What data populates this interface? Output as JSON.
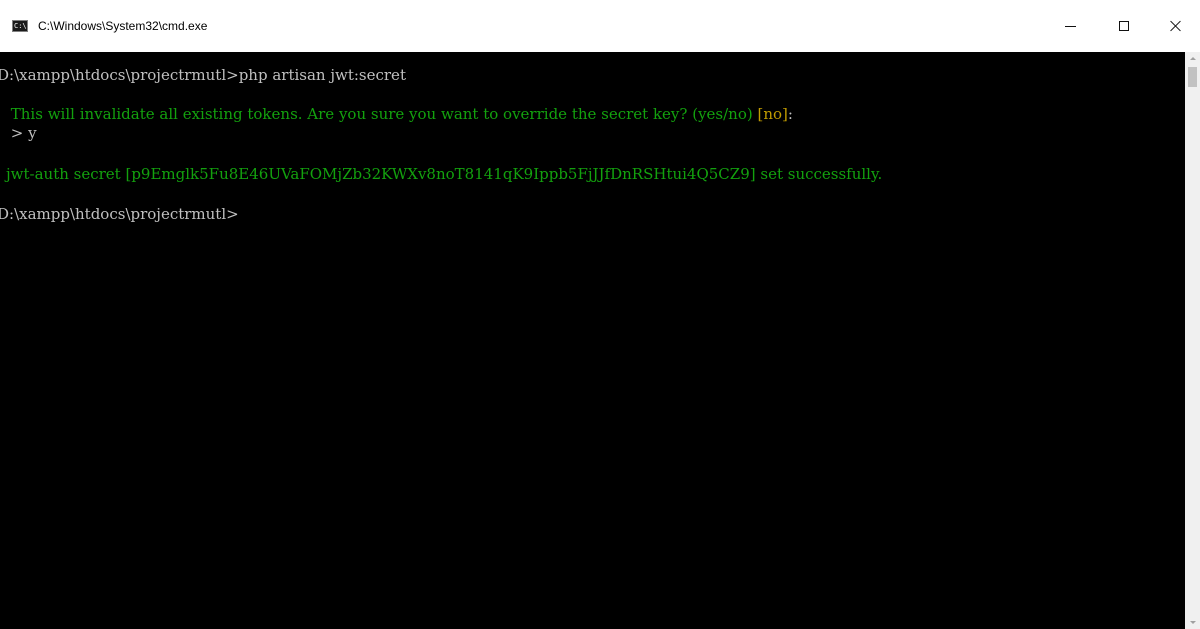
{
  "window": {
    "title": "C:\\Windows\\System32\\cmd.exe",
    "icon": "cmd-icon",
    "icon_text": "C:\\."
  },
  "controls": {
    "minimize_icon": "minimize-icon",
    "maximize_icon": "maximize-icon",
    "close_icon": "close-icon"
  },
  "console": {
    "prompt_1": "D:\\xampp\\htdocs\\projectrmutl>",
    "command_1": "php artisan jwt:secret",
    "question_text": " This will invalidate all existing tokens. Are you sure you want to override the secret key? (yes/no) ",
    "question_default": "[no]",
    "question_suffix": ":",
    "answer_line": " > y",
    "result_line": "jwt-auth secret [p9Emglk5Fu8E46UVaFOMjZb32KWXv8noT8141qK9Ippb5FjJJfDnRSHtui4Q5CZ9] set successfully.",
    "prompt_2": "D:\\xampp\\htdocs\\projectrmutl>"
  },
  "colors": {
    "background": "#000000",
    "default_text": "#c0c0c0",
    "info_text": "#13a10e",
    "default_option": "#c19c00",
    "titlebar": "#ffffff"
  }
}
